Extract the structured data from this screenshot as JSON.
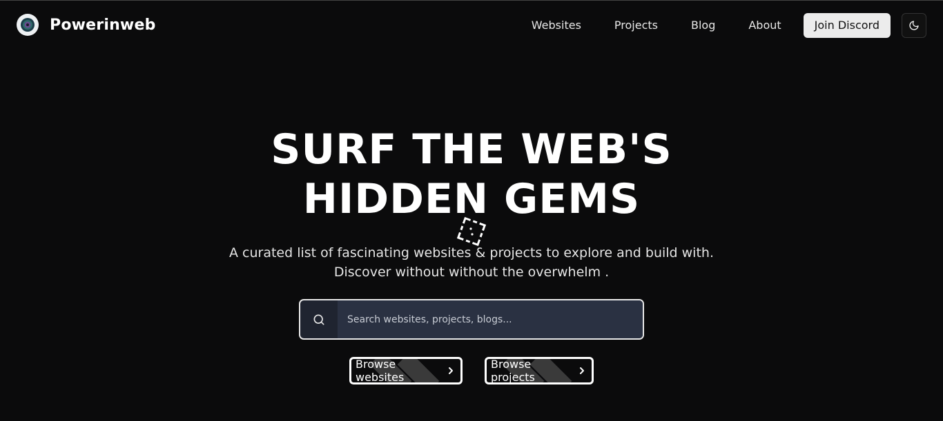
{
  "header": {
    "brand": "Powerinweb",
    "nav": [
      "Websites",
      "Projects",
      "Blog",
      "About"
    ],
    "discord_label": "Join Discord",
    "theme_icon": "moon-icon"
  },
  "hero": {
    "title_line1": "SURF THE WEB'S",
    "title_line2": "HIDDEN GEMS",
    "subtitle_line1": "A curated list of fascinating websites & projects to explore and build with.",
    "subtitle_line2": "Discover without without the overwhelm ."
  },
  "search": {
    "placeholder": "Search websites, projects, blogs...",
    "value": ""
  },
  "buttons": {
    "browse_websites": "Browse websites",
    "browse_projects": "Browse projects"
  },
  "colors": {
    "background": "#0b0b0c",
    "search_bg": "#2a3142",
    "discord_bg": "#ececec"
  }
}
